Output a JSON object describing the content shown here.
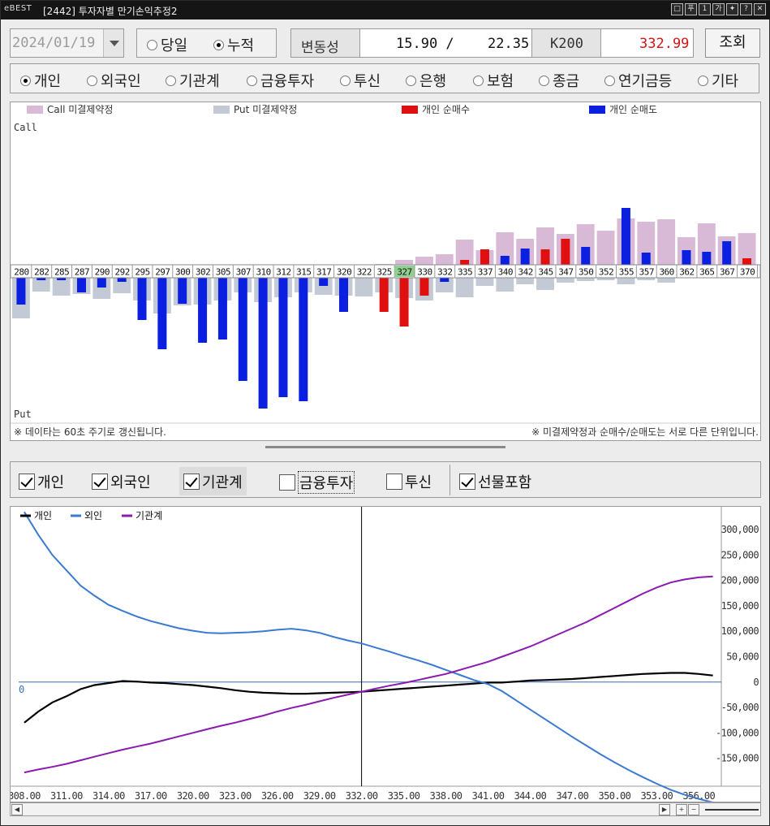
{
  "window": {
    "logo": "eBEST",
    "title": "[2442] 투자자별 만기손익추정2",
    "buttons": [
      "□",
      "푸",
      "1",
      "가",
      "✦",
      "?",
      "✕"
    ]
  },
  "toolbar": {
    "date": "2024/01/19",
    "period_options": [
      {
        "label": "당일",
        "selected": false
      },
      {
        "label": "누적",
        "selected": true
      }
    ],
    "vol_label": "변동성",
    "vol_value1": "15.90 /",
    "vol_value2": "22.35",
    "k200_label": "K200",
    "k200_value": "332.99",
    "search_label": "조회"
  },
  "investors": [
    {
      "label": "개인",
      "selected": true
    },
    {
      "label": "외국인",
      "selected": false
    },
    {
      "label": "기관계",
      "selected": false
    },
    {
      "label": "금융투자",
      "selected": false
    },
    {
      "label": "투신",
      "selected": false
    },
    {
      "label": "은행",
      "selected": false
    },
    {
      "label": "보험",
      "selected": false
    },
    {
      "label": "종금",
      "selected": false
    },
    {
      "label": "연기금등",
      "selected": false
    },
    {
      "label": "기타",
      "selected": false
    }
  ],
  "bar_chart": {
    "legend": [
      {
        "label": "Call 미결제약정",
        "color": "#d8b9d6"
      },
      {
        "label": "Put 미결제약정",
        "color": "#c3cad6"
      },
      {
        "label": "개인 순매수",
        "color": "#e01010"
      },
      {
        "label": "개인 순매도",
        "color": "#0a1fe0"
      }
    ],
    "call_label": "Call",
    "put_label": "Put",
    "highlight_strike": "327",
    "note_left": "※ 데이타는 60초 주기로 갱신됩니다.",
    "note_right": "※ 미결제약정과 순매수/순매도는 서로 다른 단위입니다."
  },
  "checkboxes": [
    {
      "label": "개인",
      "checked": true
    },
    {
      "label": "외국인",
      "checked": true
    },
    {
      "label": "기관계",
      "checked": true
    },
    {
      "label": "금융투자",
      "checked": false
    },
    {
      "label": "투신",
      "checked": false
    },
    {
      "label": "선물포함",
      "checked": true
    }
  ],
  "chart_data": [
    {
      "type": "bar",
      "categories": [
        "280",
        "282",
        "285",
        "287",
        "290",
        "292",
        "295",
        "297",
        "300",
        "302",
        "305",
        "307",
        "310",
        "312",
        "315",
        "317",
        "320",
        "322",
        "325",
        "327",
        "330",
        "332",
        "335",
        "337",
        "340",
        "342",
        "345",
        "347",
        "350",
        "352",
        "355",
        "357",
        "360",
        "362",
        "365",
        "367",
        "370"
      ],
      "series": [
        {
          "name": "Call 미결제약정",
          "values": [
            0,
            0,
            0,
            0,
            0,
            0,
            0,
            0,
            0,
            0,
            0,
            0,
            0,
            0,
            0,
            0,
            0,
            0,
            1,
            6,
            10,
            13,
            31,
            18,
            40,
            32,
            46,
            38,
            50,
            42,
            57,
            53,
            56,
            34,
            51,
            35,
            39
          ]
        },
        {
          "name": "Put 미결제약정",
          "values": [
            -50,
            -17,
            -22,
            -20,
            -26,
            -19,
            -28,
            -44,
            -34,
            -33,
            -28,
            -18,
            -30,
            -24,
            -18,
            -21,
            -22,
            -23,
            -18,
            -25,
            -28,
            -18,
            -24,
            -10,
            -17,
            -8,
            -15,
            -6,
            -4,
            -3,
            -8,
            -3,
            -6,
            0,
            0,
            0,
            0
          ]
        },
        {
          "name": "개인 순매수",
          "values": [
            0,
            0,
            0,
            0,
            0,
            0,
            0,
            0,
            0,
            0,
            0,
            0,
            0,
            0,
            0,
            0,
            0,
            0,
            -42,
            -60,
            -22,
            0,
            6,
            19,
            0,
            0,
            19,
            32,
            0,
            0,
            0,
            0,
            0,
            0,
            0,
            0,
            8
          ]
        },
        {
          "name": "개인 순매도",
          "values": [
            -33,
            -3,
            -3,
            -18,
            -12,
            -5,
            -52,
            -88,
            -32,
            -80,
            -76,
            -127,
            -161,
            -147,
            -152,
            -10,
            -42,
            0,
            0,
            0,
            0,
            -5,
            0,
            0,
            11,
            20,
            0,
            0,
            22,
            0,
            70,
            15,
            0,
            18,
            16,
            29,
            0
          ]
        }
      ],
      "xlabel": "",
      "ylabel": ""
    },
    {
      "type": "line",
      "x": [
        308,
        309,
        310,
        311,
        312,
        313,
        314,
        315,
        316,
        317,
        318,
        319,
        320,
        321,
        322,
        323,
        324,
        325,
        326,
        327,
        328,
        329,
        330,
        331,
        332,
        333,
        334,
        335,
        336,
        337,
        338,
        339,
        340,
        341,
        342,
        343,
        344,
        345,
        346,
        347,
        348,
        349,
        350,
        351,
        352,
        353,
        354,
        355,
        356,
        357
      ],
      "series": [
        {
          "name": "개인",
          "color": "#000000",
          "values": [
            -80000,
            -58000,
            -40000,
            -28000,
            -14000,
            -6000,
            -2000,
            2000,
            1000,
            -1000,
            -2000,
            -4000,
            -6000,
            -9000,
            -12000,
            -16000,
            -19000,
            -21000,
            -22000,
            -23000,
            -23000,
            -22000,
            -21000,
            -20000,
            -19000,
            -17000,
            -15000,
            -13000,
            -11000,
            -9000,
            -7000,
            -5000,
            -3000,
            -1000,
            -1000,
            1000,
            3000,
            4000,
            5000,
            6000,
            8000,
            10000,
            12000,
            14000,
            16000,
            17000,
            18000,
            18000,
            16000,
            13000
          ]
        },
        {
          "name": "외인",
          "color": "#3a7ad0",
          "values": [
            335000,
            290000,
            250000,
            220000,
            190000,
            170000,
            152000,
            140000,
            129000,
            120000,
            113000,
            106000,
            101000,
            97000,
            96000,
            97000,
            98000,
            100000,
            103000,
            105000,
            102000,
            97000,
            89000,
            82000,
            76000,
            68000,
            60000,
            51000,
            43000,
            34000,
            24000,
            14000,
            4000,
            -4000,
            -18000,
            -36000,
            -54000,
            -72000,
            -90000,
            -108000,
            -125000,
            -142000,
            -158000,
            -173000,
            -187000,
            -200000,
            -212000,
            -222000,
            -230000,
            -237000
          ]
        },
        {
          "name": "기관계",
          "color": "#8a1ab0",
          "values": [
            -178000,
            -172000,
            -167000,
            -161000,
            -154000,
            -147000,
            -140000,
            -133000,
            -127000,
            -121000,
            -114000,
            -107000,
            -100000,
            -93000,
            -86000,
            -80000,
            -73000,
            -66000,
            -58000,
            -51000,
            -45000,
            -38000,
            -31000,
            -25000,
            -19000,
            -13000,
            -7000,
            -2000,
            4000,
            10000,
            16000,
            24000,
            32000,
            40000,
            50000,
            60000,
            70000,
            82000,
            94000,
            106000,
            118000,
            132000,
            146000,
            160000,
            174000,
            186000,
            196000,
            202000,
            206000,
            208000
          ]
        }
      ],
      "ylim": [
        -200000,
        340000
      ],
      "yticks": [
        "300,000",
        "250,000",
        "200,000",
        "150,000",
        "100,000",
        "50,000",
        "0",
        "-50,000",
        "-100,000",
        "-150,000"
      ],
      "xticks": [
        "308.00",
        "311.00",
        "314.00",
        "317.00",
        "320.00",
        "323.00",
        "326.00",
        "329.00",
        "332.00",
        "335.00",
        "338.00",
        "341.00",
        "344.00",
        "347.00",
        "350.00",
        "353.00",
        "356.00"
      ],
      "zero_label": "0",
      "cursor_x": 332.0
    }
  ]
}
